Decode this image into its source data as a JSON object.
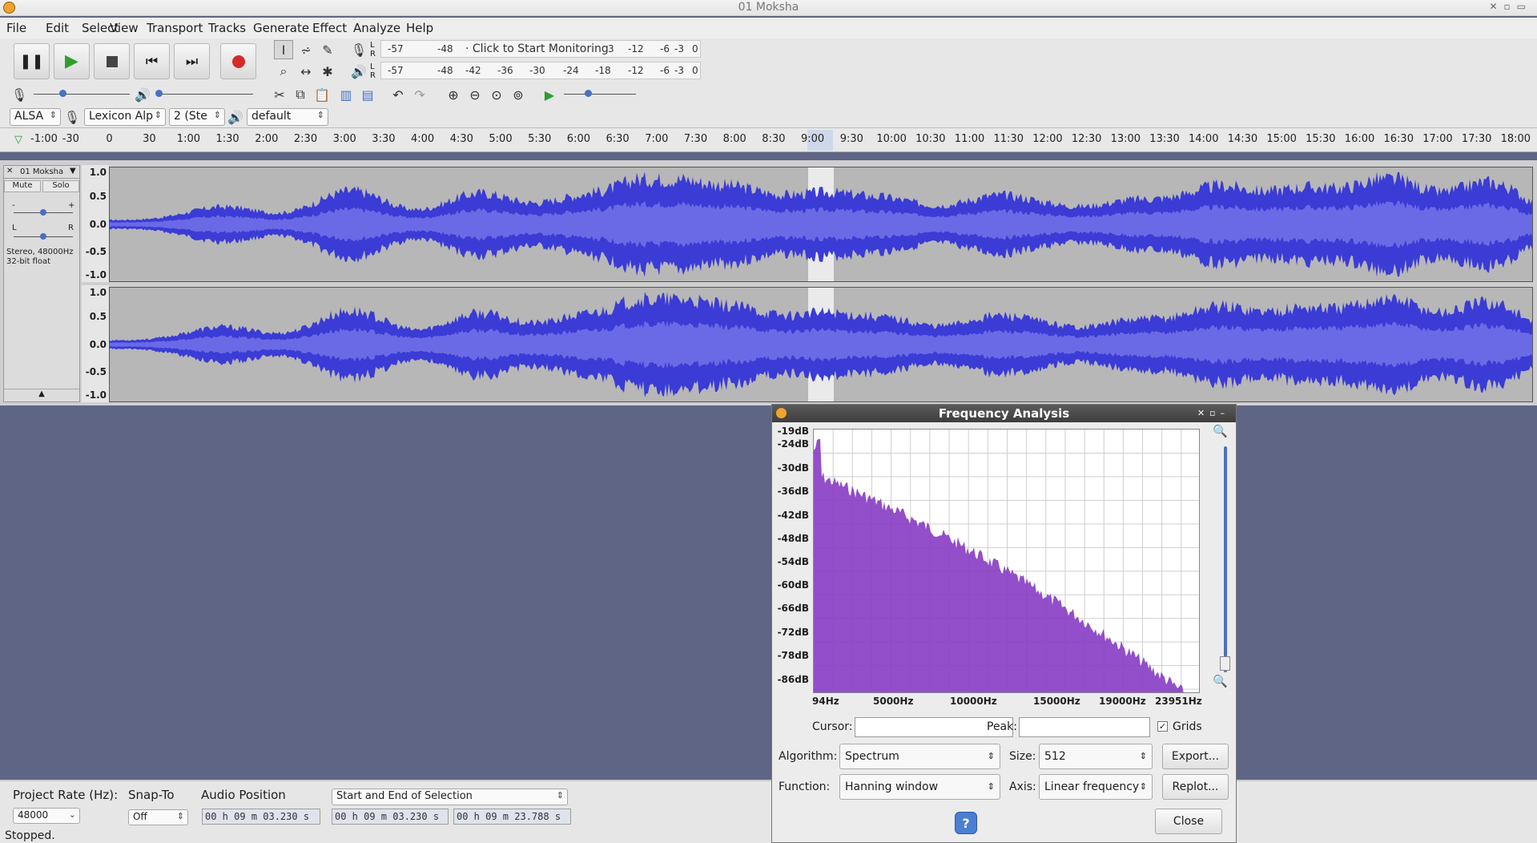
{
  "window": {
    "title": "01 Moksha"
  },
  "menu": [
    "File",
    "Edit",
    "Select",
    "View",
    "Transport",
    "Tracks",
    "Generate",
    "Effect",
    "Analyze",
    "Help"
  ],
  "meters": {
    "record": {
      "channels": "L\nR",
      "scale": [
        "-57",
        "-48"
      ],
      "prompt": "· Click to Start Monitoring",
      "scale_tail": [
        "3",
        "-12",
        "-6",
        "-3",
        "0"
      ]
    },
    "playback": {
      "channels": "L\nR",
      "scale": [
        "-57",
        "-48",
        "-42",
        "-36",
        "-30",
        "-24",
        "-18",
        "-12",
        "-6",
        "-3",
        "0"
      ]
    }
  },
  "device": {
    "host": "ALSA",
    "input": "Lexicon Alp",
    "channels": "2 (Ste",
    "output": "default"
  },
  "ruler": [
    "-1:00",
    "-30",
    "0",
    "30",
    "1:00",
    "1:30",
    "2:00",
    "2:30",
    "3:00",
    "3:30",
    "4:00",
    "4:30",
    "5:00",
    "5:30",
    "6:00",
    "6:30",
    "7:00",
    "7:30",
    "8:00",
    "8:30",
    "9:00",
    "9:30",
    "10:00",
    "10:30",
    "11:00",
    "11:30",
    "12:00",
    "12:30",
    "13:00",
    "13:30",
    "14:00",
    "14:30",
    "15:00",
    "15:30",
    "16:00",
    "16:30",
    "17:00",
    "17:30",
    "18:00"
  ],
  "track": {
    "name": "01 Moksha",
    "mute": "Mute",
    "solo": "Solo",
    "gain_minus": "-",
    "gain_plus": "+",
    "pan_left": "L",
    "pan_right": "R",
    "info1": "Stereo, 48000Hz",
    "info2": "32-bit float",
    "amp_labels": [
      "1.0",
      "0.5",
      "0.0",
      "-0.5",
      "-1.0"
    ]
  },
  "selection_bar": {
    "rate_label": "Project Rate (Hz):",
    "rate_value": "48000",
    "snap_label": "Snap-To",
    "snap_value": "Off",
    "position_label": "Audio Position",
    "selection_mode": "Start and End of Selection",
    "audio_position": "00 h 09 m 03.230 s",
    "sel_start": "00 h 09 m 03.230 s",
    "sel_end": "00 h 09 m 23.788 s"
  },
  "status": "Stopped.",
  "freq_dialog": {
    "title": "Frequency Analysis",
    "db_labels": [
      "-19dB",
      "-24dB",
      "-30dB",
      "-36dB",
      "-42dB",
      "-48dB",
      "-54dB",
      "-60dB",
      "-66dB",
      "-72dB",
      "-78dB",
      "-86dB"
    ],
    "hz_labels": [
      "94Hz",
      "5000Hz",
      "10000Hz",
      "15000Hz",
      "19000Hz",
      "23951Hz"
    ],
    "cursor_label": "Cursor:",
    "peak_label": "Peak:",
    "grids_label": "Grids",
    "grids_checked": true,
    "algorithm_label": "Algorithm:",
    "algorithm": "Spectrum",
    "size_label": "Size:",
    "size": "512",
    "function_label": "Function:",
    "function": "Hanning window",
    "axis_label": "Axis:",
    "axis": "Linear frequency",
    "export": "Export...",
    "replot": "Replot...",
    "help": "?",
    "close": "Close"
  },
  "colors": {
    "wave": "#3b3bd6",
    "wave_rms": "#6a6ae6",
    "spectrum": "#8a3fc4",
    "selection": "#ffffff"
  }
}
